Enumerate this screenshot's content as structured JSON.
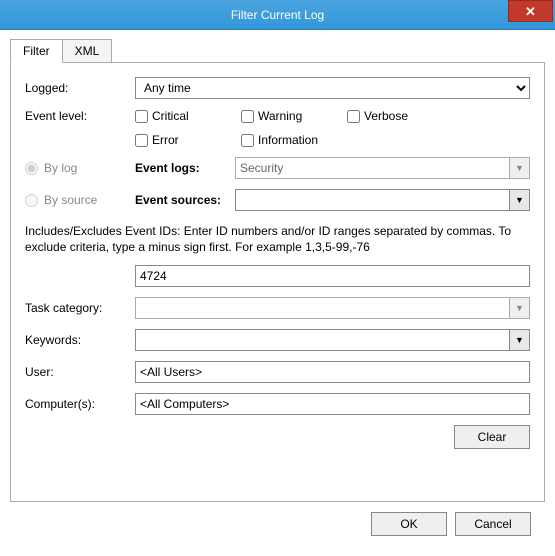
{
  "window": {
    "title": "Filter Current Log",
    "close_glyph": "✕"
  },
  "tabs": {
    "filter": "Filter",
    "xml": "XML"
  },
  "labels": {
    "logged": "Logged:",
    "event_level": "Event level:",
    "by_log": "By log",
    "by_source": "By source",
    "event_logs": "Event logs:",
    "event_sources": "Event sources:",
    "task_category": "Task category:",
    "keywords": "Keywords:",
    "user": "User:",
    "computers": "Computer(s):"
  },
  "logged_select": {
    "value": "Any time"
  },
  "levels": {
    "critical": "Critical",
    "warning": "Warning",
    "verbose": "Verbose",
    "error": "Error",
    "information": "Information"
  },
  "event_logs_value": "Security",
  "event_sources_value": "",
  "help_text": "Includes/Excludes Event IDs: Enter ID numbers and/or ID ranges separated by commas. To exclude criteria, type a minus sign first. For example 1,3,5-99,-76",
  "event_ids_value": "4724",
  "task_category_value": "",
  "keywords_value": "",
  "user_value": "<All Users>",
  "computers_value": "<All Computers>",
  "buttons": {
    "clear": "Clear",
    "ok": "OK",
    "cancel": "Cancel"
  },
  "dropdown_glyph": "▼"
}
